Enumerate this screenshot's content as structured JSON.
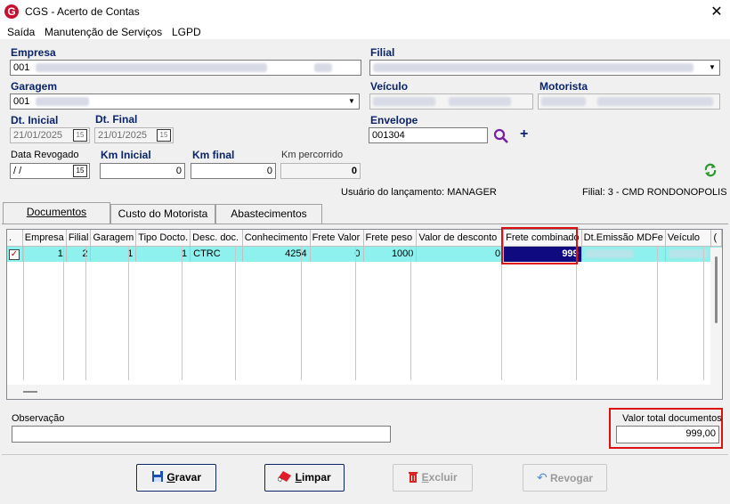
{
  "window": {
    "title": "CGS - Acerto de Contas",
    "close": "✕",
    "icon_letter": "G"
  },
  "menu": {
    "items": [
      {
        "label": "Saída"
      },
      {
        "label": "Manutenção de Serviços"
      },
      {
        "label": "LGPD"
      }
    ]
  },
  "form": {
    "empresa": {
      "label": "Empresa",
      "value_prefix": "001"
    },
    "filial": {
      "label": "Filial"
    },
    "garagem": {
      "label": "Garagem",
      "value_prefix": "001"
    },
    "veiculo": {
      "label": "Veículo"
    },
    "motorista": {
      "label": "Motorista"
    },
    "dt_inicial": {
      "label": "Dt. Inicial",
      "value": "21/01/2025"
    },
    "dt_final": {
      "label": "Dt. Final",
      "value": "21/01/2025"
    },
    "envelope": {
      "label": "Envelope",
      "value": "001304"
    },
    "data_revogado": {
      "label": "Data Revogado",
      "value": " / /"
    },
    "km_inicial": {
      "label": "Km Inicial",
      "value": "0"
    },
    "km_final": {
      "label": "Km final",
      "value": "0"
    },
    "km_percorrido": {
      "label": "Km percorrido",
      "value": "0"
    },
    "calendar_icon_text": "15",
    "usuario_text": "Usuário do lançamento: MANAGER",
    "filial_text": "Filial: 3 - CMD RONDONOPOLIS"
  },
  "tabs": [
    {
      "label": "Documentos"
    },
    {
      "label": "Custo do Motorista"
    },
    {
      "label": "Abastecimentos"
    }
  ],
  "grid": {
    "columns": [
      ".",
      "Empresa",
      "Filial",
      "Garagem",
      "Tipo Docto.",
      "Desc. doc.",
      "Conhecimento",
      "Frete Valor",
      "Frete peso",
      "Valor de desconto",
      "Frete combinado",
      "Dt.Emissão MDFe",
      "Veículo",
      "("
    ],
    "rows": [
      {
        "empresa": "1",
        "filial": "2",
        "garagem": "1",
        "tipo": "1",
        "desc": "CTRC",
        "conhecimento": "4254",
        "frete_valor": "0",
        "frete_peso": "1000",
        "desconto": "0",
        "frete_combinado": "999"
      }
    ]
  },
  "observacao": {
    "label": "Observação",
    "value": ""
  },
  "total": {
    "label": "Valor total documentos",
    "value": "999,00"
  },
  "buttons": {
    "gravar": {
      "prefix": "G",
      "rest": "ravar"
    },
    "limpar": {
      "prefix": "L",
      "rest": "impar"
    },
    "excluir": {
      "prefix": "E",
      "rest": "xcluir"
    },
    "revogar": {
      "label": "Revogar"
    }
  },
  "colors": {
    "highlight": "#0f0a80",
    "selected_row": "#8ff1ee",
    "annotation": "#dd1111",
    "label": "#0a246a"
  }
}
